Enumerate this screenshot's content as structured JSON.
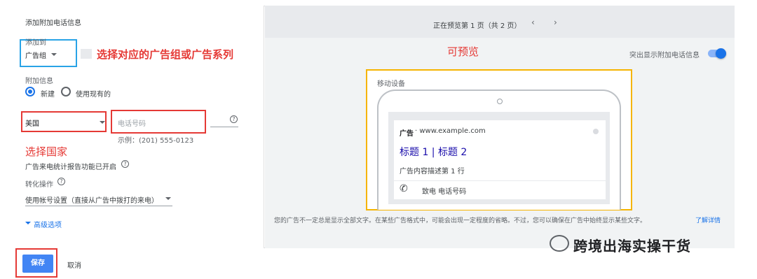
{
  "left_panel": {
    "title": "添加附加电话信息",
    "add_to_label": "添加到",
    "add_to_value": "广告组",
    "add_to_annotation": "选择对应的广告组或广告系列",
    "extension_label": "附加信息",
    "radio_new": "新建",
    "radio_existing": "使用现有的",
    "country_value": "美国",
    "phone_placeholder": "电话号码",
    "phone_example": "示例：(201) 555-0123",
    "country_annotation": "选择国家",
    "call_reporting_text": "广告来电统计报告功能已开启",
    "conversion_label": "转化操作",
    "conversion_value": "使用帐号设置（直接从广告中拨打的来电）",
    "advanced_label": "高级选项"
  },
  "preview": {
    "status": "正在预览第 1 页（共 2 页）",
    "preview_annotation": "可预览",
    "toggle_label": "突出显示附加电话信息",
    "device_label": "移动设备",
    "ad_badge": "广告",
    "ad_url": "· www.example.com",
    "ad_headline": "标题 1 | 标题 2",
    "ad_description": "广告内容描述第 1 行",
    "call_text": "致电 电话号码",
    "disclaimer": "您的广告不一定总是显示全部文字。在某些广告格式中，可能会出现一定程度的省略。不过，您可以确保在广告中始终显示某些文字。",
    "learn_more": "了解详情"
  },
  "footer": {
    "save_label": "保存",
    "cancel_label": "取消"
  },
  "watermark": {
    "text": "跨境出海实操干货"
  },
  "colors": {
    "annotation_red": "#e53935",
    "highlight_blue": "#29a3e6",
    "highlight_yellow": "#f5b400",
    "primary_blue": "#1a73e8"
  }
}
